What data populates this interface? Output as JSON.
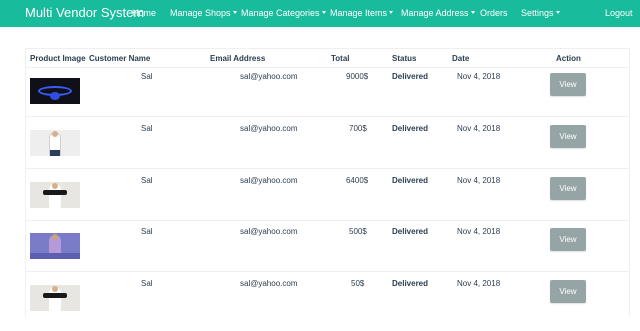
{
  "nav": {
    "brand": "Multi Vendor System",
    "items": [
      {
        "label": "Home",
        "dropdown": false
      },
      {
        "label": "Manage Shops",
        "dropdown": true
      },
      {
        "label": "Manage Categories",
        "dropdown": true
      },
      {
        "label": "Manage Items",
        "dropdown": true
      },
      {
        "label": "Manage Address",
        "dropdown": true
      },
      {
        "label": "Orders",
        "dropdown": false
      },
      {
        "label": "Settings",
        "dropdown": true
      }
    ],
    "logout": "Logout"
  },
  "table": {
    "headers": [
      "Product Image",
      "Customer Name",
      "Email Address",
      "Total",
      "Status",
      "Date",
      "Action"
    ],
    "rows": [
      {
        "image": "necklace-product-image",
        "customer": "Sal",
        "email": "sal@yahoo.com",
        "total": "9000$",
        "status": "Delivered",
        "date": "Nov 4, 2018",
        "action": "View"
      },
      {
        "image": "white-tshirt-product-image",
        "customer": "Sal",
        "email": "sal@yahoo.com",
        "total": "700$",
        "status": "Delivered",
        "date": "Nov 4, 2018",
        "action": "View"
      },
      {
        "image": "black-white-top-product-image",
        "customer": "Sal",
        "email": "sal@yahoo.com",
        "total": "6400$",
        "status": "Delivered",
        "date": "Nov 4, 2018",
        "action": "View"
      },
      {
        "image": "purple-dress-product-image",
        "customer": "Sal",
        "email": "sal@yahoo.com",
        "total": "500$",
        "status": "Delivered",
        "date": "Nov 4, 2018",
        "action": "View"
      },
      {
        "image": "black-white-top-product-image",
        "customer": "Sal",
        "email": "sal@yahoo.com",
        "total": "50$",
        "status": "Delivered",
        "date": "Nov 4, 2018",
        "action": "View"
      }
    ]
  },
  "colors": {
    "navbar": "#18bc9c",
    "view_button": "#95a5a6",
    "text": "#2c3e50"
  }
}
